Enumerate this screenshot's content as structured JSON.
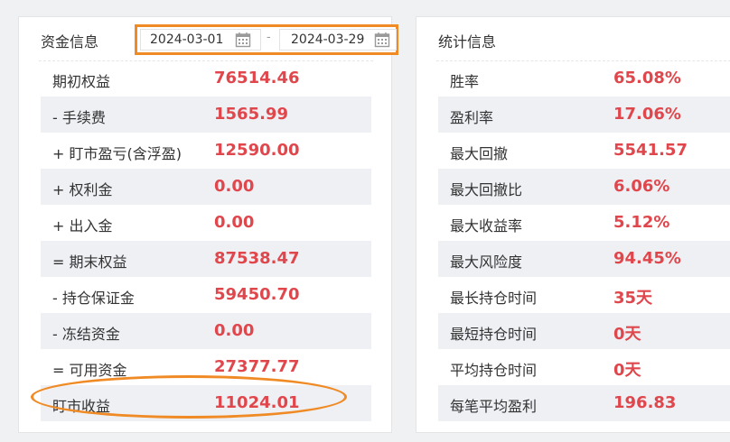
{
  "fund_info": {
    "title": "资金信息",
    "date_start": "2024-03-01",
    "date_separator": "-",
    "date_end": "2024-03-29",
    "rows": [
      {
        "label": "期初权益",
        "value": "76514.46"
      },
      {
        "label": "- 手续费",
        "value": "1565.99"
      },
      {
        "label": "+ 盯市盈亏(含浮盈)",
        "value": "12590.00"
      },
      {
        "label": "+ 权利金",
        "value": "0.00"
      },
      {
        "label": "+ 出入金",
        "value": "0.00"
      },
      {
        "label": "= 期末权益",
        "value": "87538.47"
      },
      {
        "label": "- 持仓保证金",
        "value": "59450.70"
      },
      {
        "label": "- 冻结资金",
        "value": "0.00"
      },
      {
        "label": "= 可用资金",
        "value": "27377.77"
      },
      {
        "label": "盯市收益",
        "value": "11024.01"
      }
    ]
  },
  "stats_info": {
    "title": "统计信息",
    "rows": [
      {
        "label": "胜率",
        "value": "65.08%"
      },
      {
        "label": "盈利率",
        "value": "17.06%"
      },
      {
        "label": "最大回撤",
        "value": "5541.57"
      },
      {
        "label": "最大回撤比",
        "value": "6.06%"
      },
      {
        "label": "最大收益率",
        "value": "5.12%"
      },
      {
        "label": "最大风险度",
        "value": "94.45%"
      },
      {
        "label": "最长持仓时间",
        "value": "35天"
      },
      {
        "label": "最短持仓时间",
        "value": "0天"
      },
      {
        "label": "平均持仓时间",
        "value": "0天"
      },
      {
        "label": "每笔平均盈利",
        "value": "196.83"
      }
    ]
  },
  "colors": {
    "value_red": "#e0474c",
    "annotation_orange": "#f08a24",
    "alt_row": "#eef0f4"
  },
  "icons": {
    "date_picker": "calendar-icon"
  }
}
